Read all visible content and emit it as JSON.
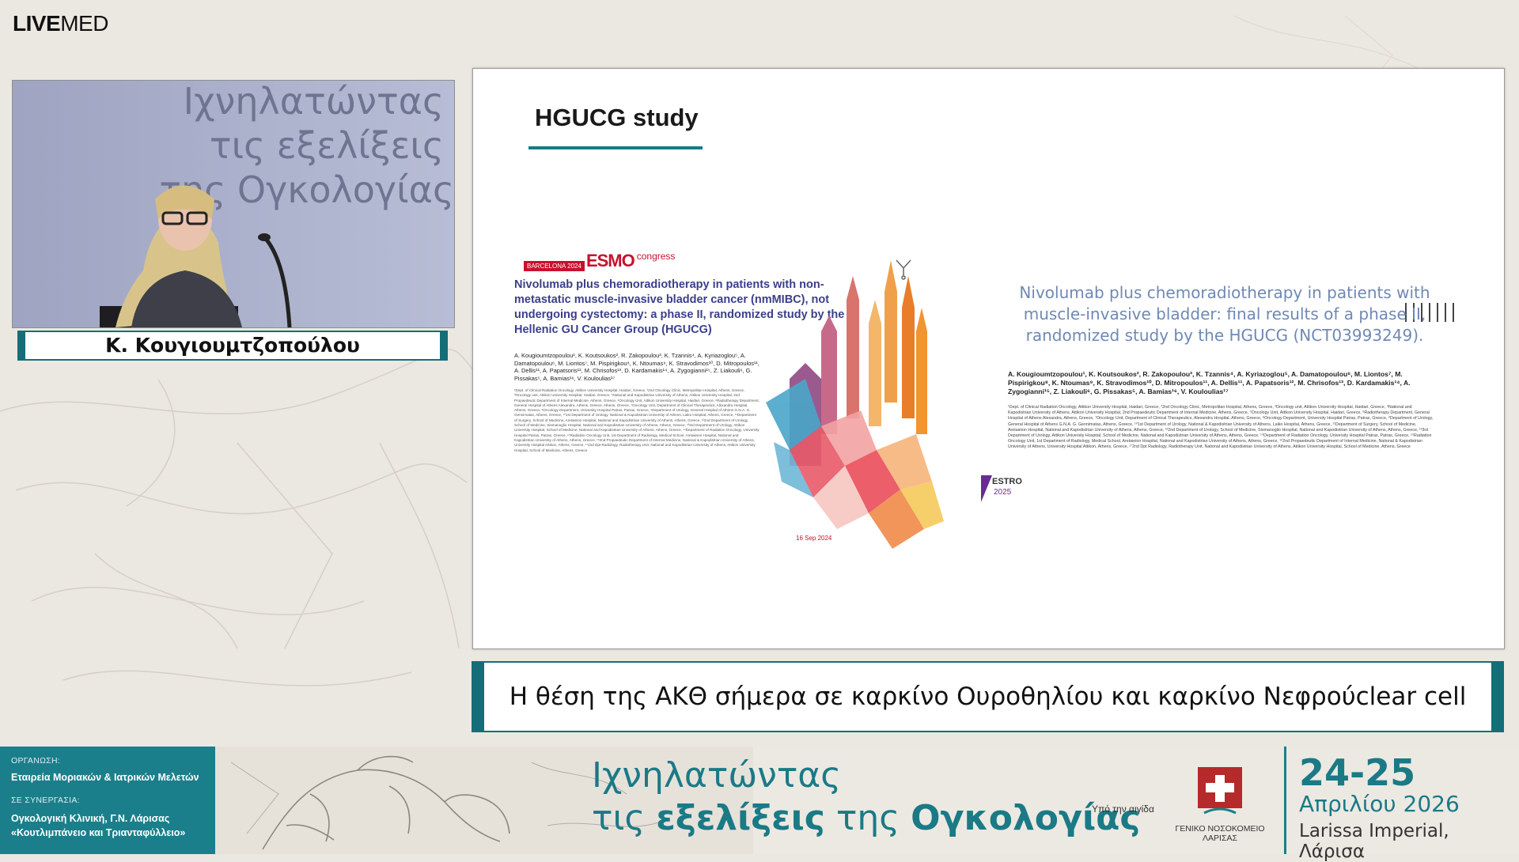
{
  "logo": {
    "live": "LIVE",
    "med": "MED"
  },
  "speaker": {
    "name": "Κ. Κουγιουμτζοπούλου",
    "backdrop_lines": [
      "Ιχνηλατώντας",
      "τις εξελίξεις",
      "της Ογκολογίας"
    ]
  },
  "slide": {
    "title": "HGUCG study",
    "left_poster": {
      "congress_city": "BARCELONA 2024",
      "congress_brand": "ESMO",
      "congress_word": "congress",
      "title": "Nivolumab plus chemoradiotherapy in patients with non-metastatic muscle-invasive bladder cancer (nmMIBC), not undergoing cystectomy: a phase II, randomized study by the Hellenic GU Cancer Group (HGUCG)",
      "authors": "A. Kougioumtzopoulou¹, K. Koutsoukos², R. Zakopoulou³, K. Tzannis⁴, A. Kyriazoglou⁵, A. Damatopoulou⁶, M. Liontos⁷, M. Pispirigkou⁸, K. Ntoumas⁹, K. Stravodimos¹⁰, D. Mitropoulos¹¹, A. Dellis¹¹, A. Papatsoris¹², M. Chrisofos¹³, D. Kardamakis¹⁴, A. Zygogianni¹⁵, Z. Liakouli⁶, G. Pissakas⁵, A. Bamias¹⁶, V. Koulouliаs¹⁷",
      "affiliations": "¹Dept. of Clinical Radiation Oncology, Attikon University Hospital, Haidari, Greece, ²2nd Oncology Clinic, Metropolitan Hospital, Athens, Greece, ³Oncology unit, Attikon University Hospital, Haidari, Greece, ⁴National and Kapodistrian University of Athens, Attikon University Hospital, 2nd Propaedeutic Department of Internal Medicine, Athens, Greece, ⁵Oncology Unit, Attikon University Hospital, Haidari, Greece, ⁶Radiotherapy Department, General Hospital of Athens Alexandra, Athens, Greece, Athens, Greece, ⁷Oncology Unit, Department of Clinical Therapeutics, Alexandra Hospital, Athens, Greece, ⁸Oncology Department, University Hospital Patras, Patras, Greece, ⁹Department of Urology, General Hospital of Athens G.N.A. G. Gennimatas, Athens, Greece, ¹⁰1st Department of Urology, National & Kapodistrian University of Athens, Laiko Hospital, Athens, Greece, ¹¹Department of Surgery, School of Medicine, Aretaieion Hospital, National and Kapodistrian University of Athens, Athens, Greece, ¹²2nd Department of Urology, School of Medicine, Sismanoglio Hospital, National and Kapodistrian University of Athens, Athens, Greece, ¹³3rd Department of Urology, Attikon University Hospital, School of Medicine, National and Kapodistrian University of Athens, Athens, Greece, ¹⁴Department of Radiation Oncology, University Hospital Patras, Patras, Greece, ¹⁵Radiation Oncology Unit, 1st Department of Radiology, Medical School, Aretaieion Hospital, National and Kapodistrian University of Athens, Athens, Greece, ¹⁶2nd Propaedeutic Department of Internal Medicine, National & Kapodistrian University of Athens, University Hospital Attikon, Athens, Greece, ¹⁷2nd Dpt Radiology, Radiotherapy Unit, National and Kapodistrian University of Athens, Attikon University Hospital, School of Medicine, Athens, Greece",
      "date": "16 Sep 2024"
    },
    "right_poster": {
      "title": "Nivolumab plus chemoradiotherapy in patients with muscle-invasive bladder: final results of a phase II, randomized study by the HGUCG (NCT03993249).",
      "authors": "A. Kougioumtzopoulou¹, K. Koutsoukos², R. Zakopoulou³, K. Tzannis⁴, A. Kyriazoglou⁵, A. Damatopoulou⁶, M. Liontos⁷, M. Pispirigkou⁸, K. Ntoumas⁹, K. Stravodimos¹⁰, D. Mitropoulos¹¹, A. Dellis¹¹, A. Papatsoris¹², M. Chrisofos¹³, D. Kardamakis¹⁴, A. Zygogianni¹⁵, Z. Liakouli⁶, G. Pissakas⁵, A. Bamias¹⁶, V. Koulouliаs¹⁷",
      "affiliations": "¹Dept. of Clinical Radiation Oncology, Attikon University Hospital, Haidari, Greece, ²2nd Oncology Clinic, Metropolitan Hospital, Athens, Greece, ³Oncology unit, Attikon University Hospital, Haidari, Greece, ⁴National and Kapodistrian University of Athens, Attikon University Hospital, 2nd Propaedeutic Department of Internal Medicine, Athens, Greece, ⁵Oncology Unit, Attikon University Hospital, Haidari, Greece, ⁶Radiotherapy Department, General Hospital of Athens Alexandra, Athens, Greece, ⁷Oncology Unit, Department of Clinical Therapeutics, Alexandra Hospital, Athens, Greece, ⁸Oncology Department, University Hospital Patras, Patras, Greece, ⁹Department of Urology, General Hospital of Athens G.N.A. G. Gennimatas, Athens, Greece, ¹⁰1st Department of Urology, National & Kapodistrian University of Athens, Laiko Hospital, Athens, Greece, ¹¹Department of Surgery, School of Medicine, Aretaieion Hospital, National and Kapodistrian University of Athens, Athens, Greece, ¹²2nd Department of Urology, School of Medicine, Sismanoglio Hospital, National and Kapodistrian University of Athens, Athens, Greece, ¹³3rd Department of Urology, Attikon University Hospital, School of Medicine, National and Kapodistrian University of Athens, Athens, Greece, ¹⁴Department of Radiation Oncology, University Hospital Patras, Patras, Greece, ¹⁵Radiation Oncology Unit, 1st Department of Radiology, Medical School, Aretaieion Hospital, National and Kapodistrian University of Athens, Athens, Greece, ¹⁶2nd Propaedeutic Department of Internal Medicine, National & Kapodistrian University of Athens, University Hospital Attikon, Athens, Greece, ¹⁷2nd Dpt Radiology, Radiotherapy Unit, National and Kapodistrian University of Athens, Attikon University Hospital, School of Medicine, Athens, Greece",
      "logo_word": "ESTRO",
      "logo_year": "2025"
    }
  },
  "subtitle": "Η θέση της ΑΚΘ σήμερα σε καρκίνο Ουροθηλίου και καρκίνο Νεφρούclear cell",
  "banner": {
    "org_label": "ΟΡΓΑΝΩΣΗ:",
    "org_value": "Εταιρεία Μοριακών & Ιατρικών Μελετών",
    "collab_label": "ΣΕ ΣΥΝΕΡΓΑΣΙΑ:",
    "collab_line1": "Ογκολογική Κλινική, Γ.Ν. Λάρισας",
    "collab_line2": "«Κουτλιμπάνειο και Τριανταφύλλειο»",
    "event_line1": "Ιχνηλατώντας",
    "event_line2_a": "τις ",
    "event_line2_b": "εξελίξεις",
    "event_line2_c": " της ",
    "event_line2_d": "Ογκολογίας",
    "aegis": "Υπό την αιγίδα",
    "hospital": "ΓΕΝΙΚΟ ΝΟΣΟΚΟΜΕΙΟ ΛΑΡΙΣΑΣ",
    "dates": "24-25",
    "month": "Απριλίου 2026",
    "venue": "Larissa Imperial, Λάρισα"
  },
  "colors": {
    "teal": "#1b7f8b",
    "teal_dark": "#136e78",
    "slide_title_blue": "#3b3f8a",
    "final_title_blue": "#6f89b4",
    "esmo_red": "#c8102e"
  }
}
